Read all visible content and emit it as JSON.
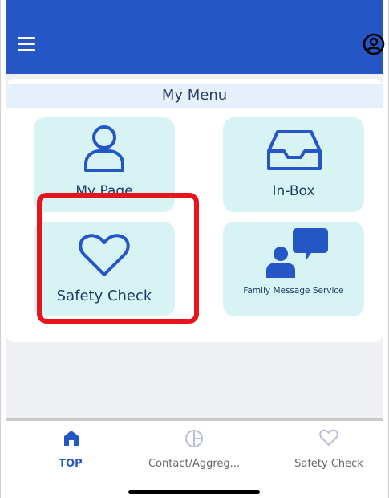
{
  "header": {
    "menu_icon": "hamburger-menu-icon",
    "account_icon": "user-circle-icon"
  },
  "menu": {
    "title": "My Menu",
    "tiles": [
      {
        "label": "My Page",
        "icon": "person-icon"
      },
      {
        "label": "In-Box",
        "icon": "inbox-tray-icon"
      },
      {
        "label": "Safety Check",
        "icon": "heart-icon"
      },
      {
        "label": "Family Message Service",
        "icon": "family-message-icon"
      }
    ]
  },
  "tabbar": {
    "tabs": [
      {
        "label": "TOP",
        "icon": "home-icon",
        "active": true
      },
      {
        "label": "Contact/Aggreg...",
        "icon": "contact-aggregate-icon",
        "active": false
      },
      {
        "label": "Safety Check",
        "icon": "heart-outline-icon",
        "active": false
      }
    ]
  },
  "colors": {
    "header_bg": "#2457c5",
    "tile_bg": "#d8f3f3",
    "icon_blue": "#2457c5",
    "highlight": "#e8141b",
    "menu_title_bg": "#e6f0fb"
  }
}
